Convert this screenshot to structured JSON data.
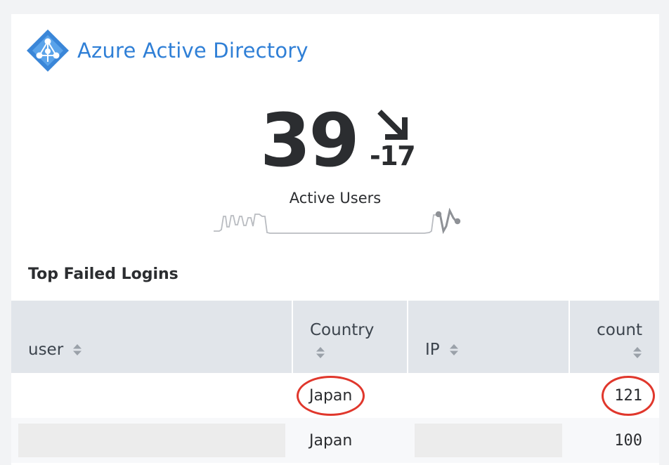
{
  "brand": {
    "name": "Azure Active Directory",
    "logo_icon": "azure-ad-diamond-icon",
    "color": "#2f7fd6"
  },
  "kpi": {
    "value": "39",
    "delta": "-17",
    "trend": "down",
    "label": "Active Users"
  },
  "section": {
    "title": "Top Failed Logins"
  },
  "table": {
    "columns": [
      {
        "label": "user",
        "sortable": true
      },
      {
        "label": "Country",
        "sortable": true
      },
      {
        "label": "IP",
        "sortable": true
      },
      {
        "label": "count",
        "sortable": true
      }
    ],
    "rows": [
      {
        "user": "",
        "country": "Japan",
        "ip": "",
        "count": "121",
        "highlighted": true
      },
      {
        "user": "",
        "country": "Japan",
        "ip": "",
        "count": "100",
        "highlighted": false
      }
    ]
  },
  "annotation_color": "#e0372c"
}
